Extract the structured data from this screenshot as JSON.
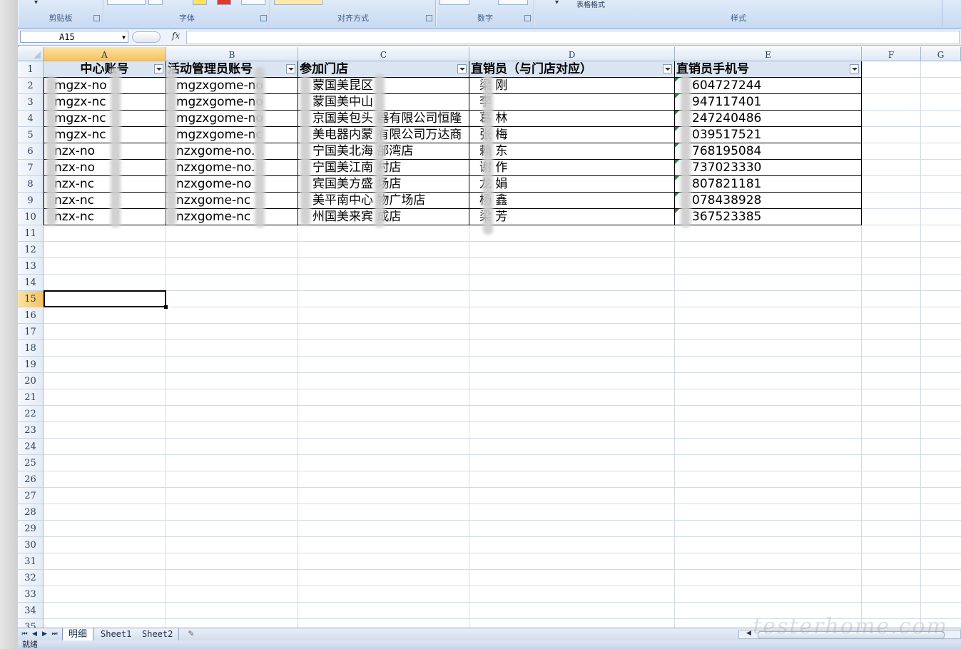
{
  "ribbon": {
    "groups": [
      "剪贴板",
      "字体",
      "对齐方式",
      "数字",
      "样式"
    ],
    "table_format_label": "表格格式"
  },
  "formula_bar": {
    "name_box": "A15",
    "fx_label": "fx",
    "formula": ""
  },
  "grid": {
    "columns": [
      "A",
      "B",
      "C",
      "D",
      "E",
      "F",
      "G"
    ],
    "rows": [
      "1",
      "2",
      "3",
      "4",
      "5",
      "6",
      "7",
      "8",
      "9",
      "10",
      "11",
      "12",
      "13",
      "14",
      "15",
      "16",
      "17",
      "18",
      "19",
      "20",
      "21",
      "22",
      "23",
      "24",
      "25",
      "26",
      "27",
      "28",
      "29",
      "30",
      "31",
      "32",
      "33",
      "34",
      "35"
    ],
    "active_cell": "A15"
  },
  "table": {
    "headers": [
      "中心账号",
      "活动管理员账号",
      "参加门店",
      "直销员（与门店对应）",
      "直销员手机号"
    ],
    "rows": [
      [
        "mgzx-no",
        "mgzxgome-no",
        "蒙国美昆区",
        "梁 刚",
        "604727244"
      ],
      [
        "mgzx-nc",
        "mgzxgome-no",
        "蒙国美中山",
        "李",
        "947117401"
      ],
      [
        "mgzx-nc",
        "mgzxgome-no",
        "京国美包头 器有限公司恒隆",
        "葛 林",
        "247240486"
      ],
      [
        "mgzx-nc",
        "mgzxgome-nc",
        "美电器内蒙 有限公司万达商",
        "张 梅",
        "039517521"
      ],
      [
        "nzx-no",
        "nzxgome-no.",
        "宁国美北海 部湾店",
        "赖 东",
        "768195084"
      ],
      [
        "nzx-no",
        "nzxgome-no.",
        "宁国美江南 村店",
        "谢 作",
        "737023330"
      ],
      [
        "nzx-nc",
        "nzxgome-no",
        "宾国美方盛 场店",
        "龙 娟",
        "807821181"
      ],
      [
        "nzx-nc",
        "nzxgome-nc",
        "美平南中心 物广场店",
        "杨 鑫",
        "078438928"
      ],
      [
        "nzx-nc",
        "nzxgome-nc",
        "州国美来宾 成店",
        "梁 芳",
        "367523385"
      ]
    ]
  },
  "sheet_tabs": [
    "明细",
    "Sheet1",
    "Sheet2"
  ],
  "status_bar": {
    "text": "就绪"
  },
  "watermark": "testerhome.com",
  "colors": {
    "header_fill": "#dbe5f1",
    "active_header": "#f6c25f",
    "ribbon": "#c7daf2"
  }
}
